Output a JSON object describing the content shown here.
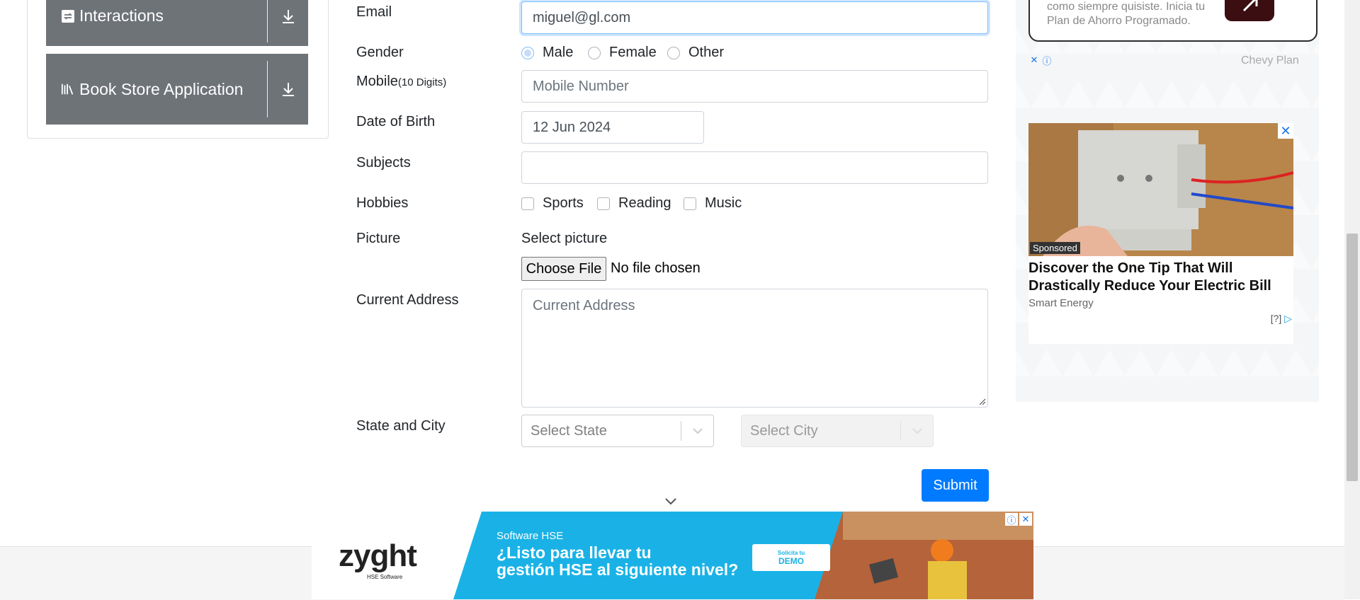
{
  "sidebar": {
    "groups": [
      {
        "label": "Interactions"
      },
      {
        "label": "Book Store Application"
      }
    ]
  },
  "form": {
    "email_label": "Email",
    "email_value": "miguel@gl.com",
    "gender_label": "Gender",
    "gender_options": [
      "Male",
      "Female",
      "Other"
    ],
    "gender_selected": "Male",
    "mobile_label": "Mobile",
    "mobile_hint": "(10 Digits)",
    "mobile_placeholder": "Mobile Number",
    "dob_label": "Date of Birth",
    "dob_value": "12 Jun 2024",
    "subjects_label": "Subjects",
    "hobbies_label": "Hobbies",
    "hobbies_options": [
      "Sports",
      "Reading",
      "Music"
    ],
    "picture_label": "Picture",
    "picture_select_label": "Select picture",
    "choose_file_label": "Choose File",
    "no_file_text": "No file chosen",
    "address_label": "Current Address",
    "address_placeholder": "Current Address",
    "state_city_label": "State and City",
    "state_placeholder": "Select State",
    "city_placeholder": "Select City",
    "submit_label": "Submit"
  },
  "ads": {
    "top_ad_text_line1": "como siempre quisiste. Inicia tu",
    "top_ad_text_line2": "Plan de Ahorro Programado.",
    "top_ad_brand": "Chevy Plan",
    "side_ad": {
      "badge": "Sponsored",
      "title": "Discover the One Tip That Will Drastically Reduce Your Electric Bill",
      "brand": "Smart Energy",
      "footer": "[?]"
    },
    "banner": {
      "logo": "zyght",
      "logo_sub": "HSE Software",
      "small_text": "Software HSE",
      "headline_line1": "¿Listo para llevar tu",
      "headline_line2": "gestión HSE al siguiente nivel?",
      "cta_small": "Solicita tu",
      "cta_big": "DEMO"
    }
  },
  "colors": {
    "primary": "#007bff",
    "sidebar_header": "#6e7378",
    "banner_bg": "#1ab2e6"
  }
}
